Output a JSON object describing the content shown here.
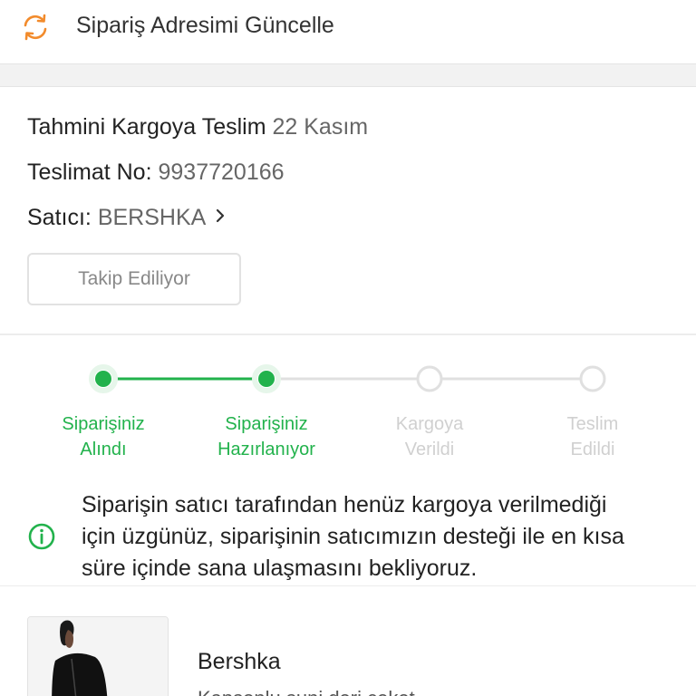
{
  "header": {
    "title": "Sipariş Adresimi Güncelle",
    "icon": "refresh-icon",
    "icon_color": "#f28b2c"
  },
  "order_info": {
    "estimate_label": "Tahmini Kargoya Teslim",
    "estimate_value": "22 Kasım",
    "delivery_no_label": "Teslimat No:",
    "delivery_no_value": "9937720166",
    "seller_label": "Satıcı:",
    "seller_value": "BERSHKA",
    "follow_button": "Takip Ediliyor"
  },
  "tracker": {
    "active_color": "#22b24c",
    "inactive_color": "#e0e0e0",
    "steps": [
      {
        "line1": "Siparişiniz",
        "line2": "Alındı",
        "state": "done"
      },
      {
        "line1": "Siparişiniz",
        "line2": "Hazırlanıyor",
        "state": "done"
      },
      {
        "line1": "Kargoya",
        "line2": "Verildi",
        "state": "pending"
      },
      {
        "line1": "Teslim",
        "line2": "Edildi",
        "state": "pending"
      }
    ]
  },
  "notice": {
    "icon": "info-icon",
    "line1": "Siparişin satıcı tarafından henüz kargoya verilmediği",
    "line2": "için üzgünüz, siparişinin satıcımızın desteği ile en kısa",
    "line3": "süre içinde sana ulaşmasını bekliyoruz."
  },
  "product": {
    "brand": "Bershka",
    "subtitle": "Kapşonlu suni deri ceket"
  }
}
